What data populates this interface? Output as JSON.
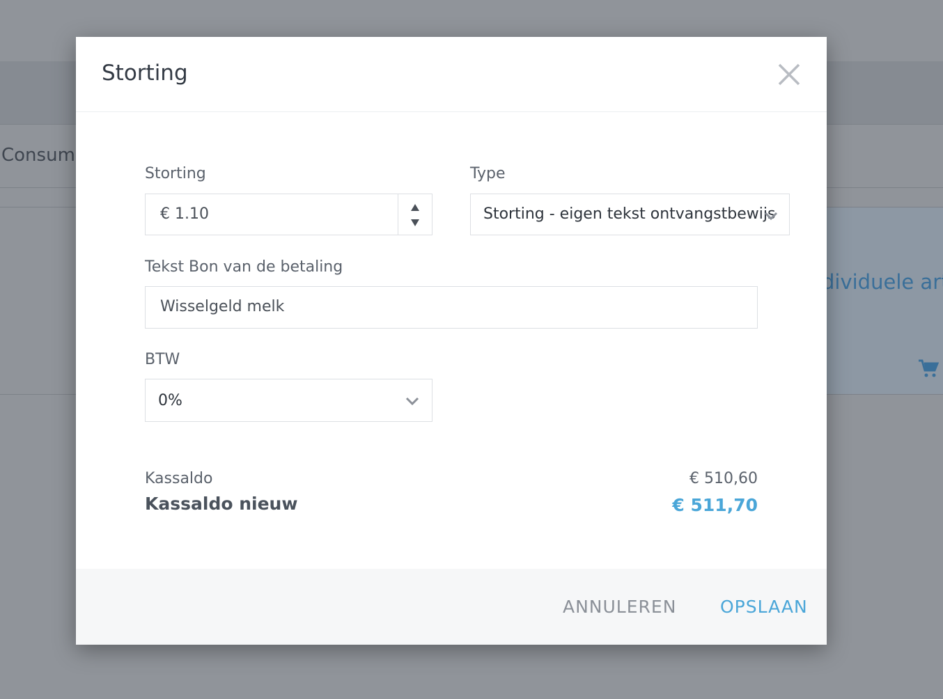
{
  "background": {
    "tab_text": "Consump",
    "panel_text": "dividuele art"
  },
  "modal": {
    "title": "Storting",
    "fields": {
      "amount": {
        "label": "Storting",
        "value": "€ 1.10"
      },
      "type": {
        "label": "Type",
        "value": "Storting - eigen tekst ontvangstbewijs"
      },
      "receipt_text": {
        "label": "Tekst Bon van de betaling",
        "value": "Wisselgeld melk"
      },
      "vat": {
        "label": "BTW",
        "value": "0%"
      }
    },
    "summary": {
      "balance_label": "Kassaldo",
      "balance_value": "€ 510,60",
      "new_balance_label": "Kassaldo nieuw",
      "new_balance_value": "€ 511,70"
    },
    "footer": {
      "cancel_label": "ANNULEREN",
      "save_label": "OPSLAAN"
    }
  },
  "colors": {
    "accent": "#4aa6d8",
    "overlay": "#90949a"
  },
  "icons": [
    "close-icon",
    "stepper-up-icon",
    "stepper-down-icon",
    "chevron-down-icon",
    "cart-icon"
  ]
}
